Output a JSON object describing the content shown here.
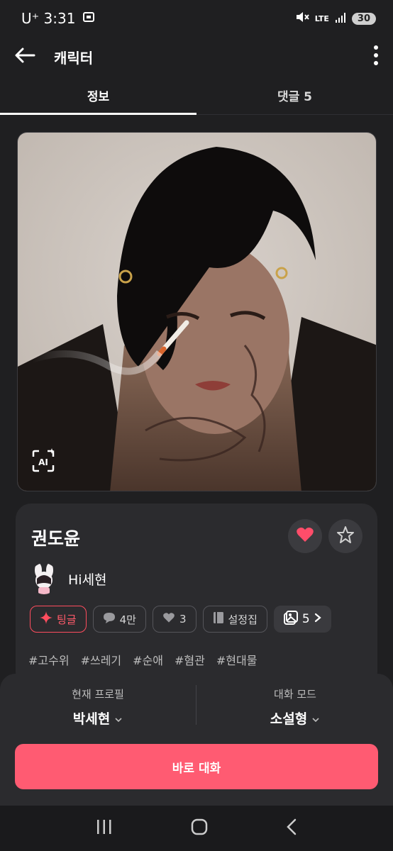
{
  "status": {
    "carrier_time": "U⁺ 3:31",
    "network": "LTE",
    "battery": "30"
  },
  "appbar": {
    "title": "캐릭터"
  },
  "tabs": [
    {
      "label": "정보",
      "active": true
    },
    {
      "label": "댓글 5",
      "active": false
    }
  ],
  "character": {
    "name": "권도윤",
    "ai_badge": "AI",
    "author": "Hi세현"
  },
  "chips": {
    "tingle": "팅글",
    "chats": "4만",
    "likes": "3",
    "settings": "설정집",
    "images": "5"
  },
  "tags": [
    "#고수위",
    "#쓰레기",
    "#순애",
    "#혐관",
    "#현대물"
  ],
  "sheet": {
    "profile_label": "현재 프로필",
    "profile_value": "박세현",
    "mode_label": "대화 모드",
    "mode_value": "소설형",
    "start_label": "바로 대화"
  },
  "colors": {
    "accent": "#ff5b72",
    "heart": "#ff4d6a",
    "background": "#1f1f21",
    "card": "#2b2b2e"
  }
}
